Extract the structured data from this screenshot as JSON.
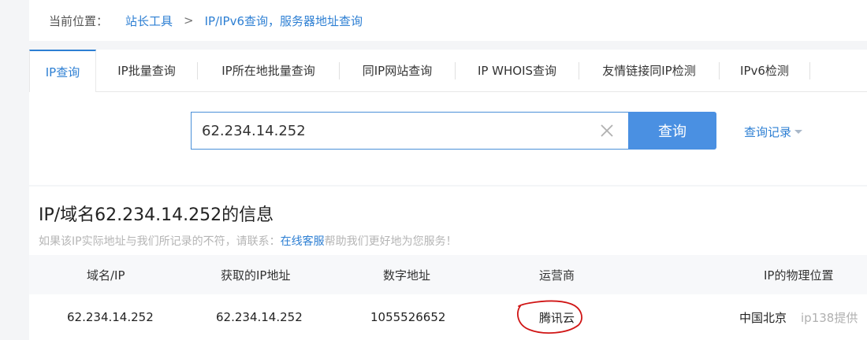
{
  "breadcrumb": {
    "label": "当前位置：",
    "root": "站长工具",
    "separator": ">",
    "current": "IP/IPv6查询，服务器地址查询"
  },
  "tabs": [
    {
      "label": "IP查询",
      "active": true
    },
    {
      "label": "IP批量查询",
      "active": false
    },
    {
      "label": "IP所在地批量查询",
      "active": false
    },
    {
      "label": "同IP网站查询",
      "active": false
    },
    {
      "label": "IP WHOIS查询",
      "active": false
    },
    {
      "label": "友情链接同IP检测",
      "active": false
    },
    {
      "label": "IPv6检测",
      "active": false
    }
  ],
  "search": {
    "value": "62.234.14.252",
    "button_label": "查询",
    "history_label": "查询记录"
  },
  "info": {
    "title": "IP/域名62.234.14.252的信息",
    "note_prefix": "如果该IP实际地址与我们所记录的不符，请联系：",
    "note_link": "在线客服",
    "note_suffix": "帮助我们更好地为您服务！",
    "columns": [
      "域名/IP",
      "获取的IP地址",
      "数字地址",
      "运营商",
      "IP的物理位置"
    ],
    "row": {
      "domain": "62.234.14.252",
      "ip": "62.234.14.252",
      "numeric": "1055526652",
      "provider": "腾讯云",
      "location": "中国北京",
      "source": "ip138提供"
    }
  },
  "colors": {
    "accent": "#2d7fd3",
    "button": "#4a90e2",
    "annotation": "#d01515"
  }
}
